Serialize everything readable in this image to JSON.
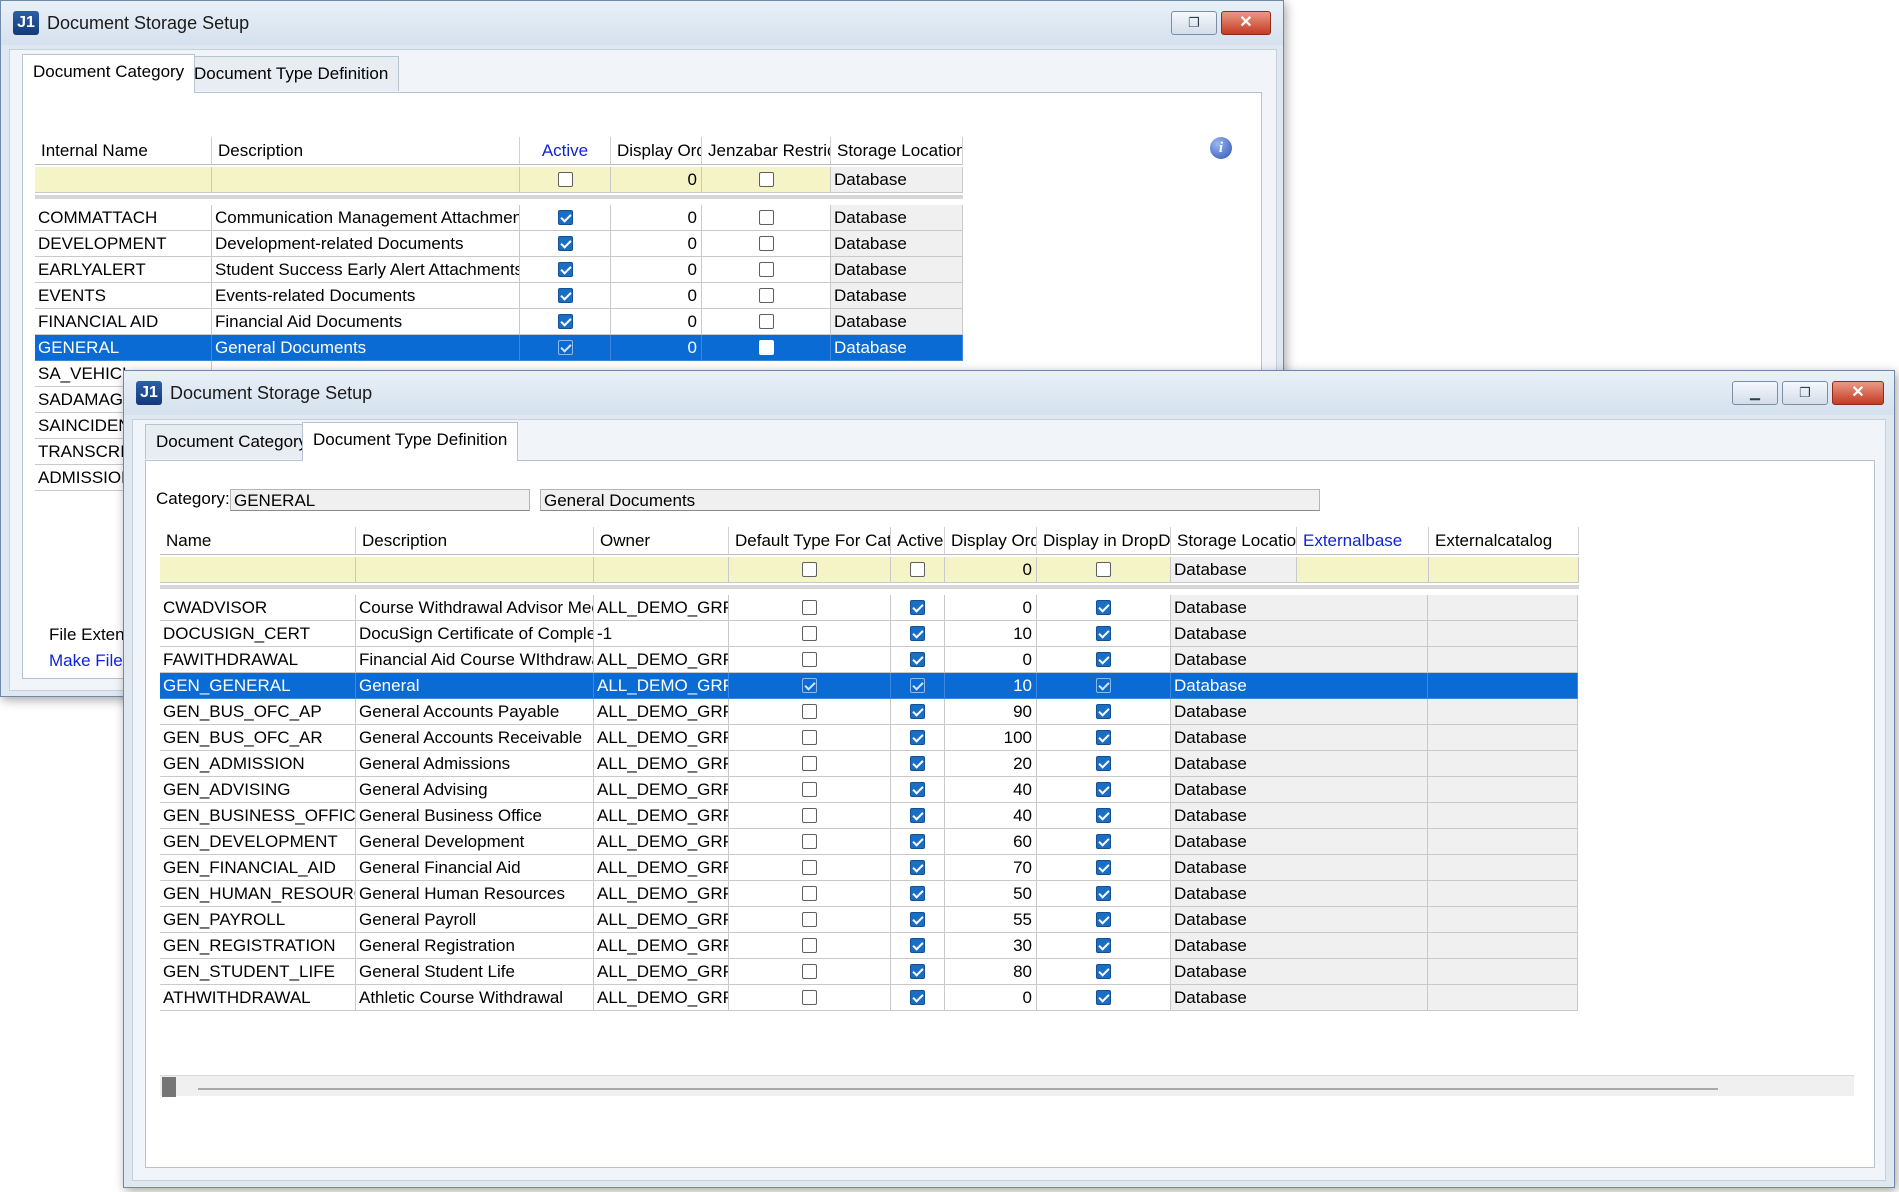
{
  "back_window": {
    "title": "Document Storage Setup",
    "tabs": [
      "Document Category",
      "Document Type Definition"
    ],
    "columns": [
      "Internal Name",
      "Description",
      "Active",
      "Display Order",
      "Jenzabar Restricted",
      "Storage Location"
    ],
    "new_row": {
      "display_order": "0",
      "storage_location": "Database"
    },
    "rows": [
      {
        "name": "COMMATTACH",
        "description": "Communication Management Attachments",
        "active": true,
        "display_order": "0",
        "restricted": false,
        "storage": "Database"
      },
      {
        "name": "DEVELOPMENT",
        "description": "Development-related Documents",
        "active": true,
        "display_order": "0",
        "restricted": false,
        "storage": "Database"
      },
      {
        "name": "EARLYALERT",
        "description": "Student Success Early Alert Attachments",
        "active": true,
        "display_order": "0",
        "restricted": false,
        "storage": "Database"
      },
      {
        "name": "EVENTS",
        "description": "Events-related Documents",
        "active": true,
        "display_order": "0",
        "restricted": false,
        "storage": "Database"
      },
      {
        "name": "FINANCIAL AID",
        "description": "Financial Aid Documents",
        "active": true,
        "display_order": "0",
        "restricted": false,
        "storage": "Database"
      },
      {
        "name": "GENERAL",
        "description": "General Documents",
        "active": true,
        "display_order": "0",
        "restricted": false,
        "storage": "Database",
        "selected": true
      },
      {
        "name": "SA_VEHICL"
      },
      {
        "name": "SADAMAGE"
      },
      {
        "name": "SAINCIDEN"
      },
      {
        "name": "TRANSCRI"
      },
      {
        "name": "ADMISSION"
      }
    ],
    "file_extensions_label": "File Extens",
    "make_file_link": "Make File I"
  },
  "front_window": {
    "title": "Document Storage Setup",
    "tabs": [
      "Document Category",
      "Document Type Definition"
    ],
    "category_label": "Category:",
    "category_value": "GENERAL",
    "category_description": "General Documents",
    "columns": [
      "Name",
      "Description",
      "Owner",
      "Default Type For Category",
      "Active",
      "Display Order",
      "Display in DropDown",
      "Storage Location",
      "Externalbase",
      "Externalcatalog"
    ],
    "new_row": {
      "display_order": "0",
      "storage_location": "Database"
    },
    "rows": [
      {
        "name": "CWADVISOR",
        "description": "Course Withdrawal Advisor Meeting",
        "owner": "ALL_DEMO_GRP",
        "default_type": false,
        "active": true,
        "display_order": "0",
        "dropdown": true,
        "storage": "Database"
      },
      {
        "name": "DOCUSIGN_CERT",
        "description": "DocuSign Certificate of Completion",
        "owner": "-1",
        "default_type": false,
        "active": true,
        "display_order": "10",
        "dropdown": true,
        "storage": "Database"
      },
      {
        "name": "FAWITHDRAWAL",
        "description": "Financial Aid Course WIthdrawal",
        "owner": "ALL_DEMO_GRP",
        "default_type": false,
        "active": true,
        "display_order": "0",
        "dropdown": true,
        "storage": "Database"
      },
      {
        "name": "GEN_GENERAL",
        "description": "General",
        "owner": "ALL_DEMO_GRP",
        "default_type": true,
        "active": true,
        "display_order": "10",
        "dropdown": true,
        "storage": "Database",
        "selected": true
      },
      {
        "name": "GEN_BUS_OFC_AP",
        "description": "General Accounts Payable",
        "owner": "ALL_DEMO_GRP",
        "default_type": false,
        "active": true,
        "display_order": "90",
        "dropdown": true,
        "storage": "Database"
      },
      {
        "name": "GEN_BUS_OFC_AR",
        "description": "General Accounts Receivable",
        "owner": "ALL_DEMO_GRP",
        "default_type": false,
        "active": true,
        "display_order": "100",
        "dropdown": true,
        "storage": "Database"
      },
      {
        "name": "GEN_ADMISSION",
        "description": "General Admissions",
        "owner": "ALL_DEMO_GRP",
        "default_type": false,
        "active": true,
        "display_order": "20",
        "dropdown": true,
        "storage": "Database"
      },
      {
        "name": "GEN_ADVISING",
        "description": "General Advising",
        "owner": "ALL_DEMO_GRP",
        "default_type": false,
        "active": true,
        "display_order": "40",
        "dropdown": true,
        "storage": "Database"
      },
      {
        "name": "GEN_BUSINESS_OFFICE",
        "description": "General Business Office",
        "owner": "ALL_DEMO_GRP",
        "default_type": false,
        "active": true,
        "display_order": "40",
        "dropdown": true,
        "storage": "Database"
      },
      {
        "name": "GEN_DEVELOPMENT",
        "description": "General Development",
        "owner": "ALL_DEMO_GRP",
        "default_type": false,
        "active": true,
        "display_order": "60",
        "dropdown": true,
        "storage": "Database"
      },
      {
        "name": "GEN_FINANCIAL_AID",
        "description": "General Financial Aid",
        "owner": "ALL_DEMO_GRP",
        "default_type": false,
        "active": true,
        "display_order": "70",
        "dropdown": true,
        "storage": "Database"
      },
      {
        "name": "GEN_HUMAN_RESOURCES",
        "description": "General Human Resources",
        "owner": "ALL_DEMO_GRP",
        "default_type": false,
        "active": true,
        "display_order": "50",
        "dropdown": true,
        "storage": "Database"
      },
      {
        "name": "GEN_PAYROLL",
        "description": "General Payroll",
        "owner": "ALL_DEMO_GRP",
        "default_type": false,
        "active": true,
        "display_order": "55",
        "dropdown": true,
        "storage": "Database"
      },
      {
        "name": "GEN_REGISTRATION",
        "description": "General Registration",
        "owner": "ALL_DEMO_GRP",
        "default_type": false,
        "active": true,
        "display_order": "30",
        "dropdown": true,
        "storage": "Database"
      },
      {
        "name": "GEN_STUDENT_LIFE",
        "description": "General Student Life",
        "owner": "ALL_DEMO_GRP",
        "default_type": false,
        "active": true,
        "display_order": "80",
        "dropdown": true,
        "storage": "Database"
      },
      {
        "name": "ATHWITHDRAWAL",
        "description": "Athletic Course Withdrawal",
        "owner": "ALL_DEMO_GRP",
        "default_type": false,
        "active": true,
        "display_order": "0",
        "dropdown": true,
        "storage": "Database"
      }
    ]
  },
  "colors": {
    "selection": "#0a6bd5",
    "new_row": "#f4f4c6",
    "link_header": "#1122dd"
  }
}
